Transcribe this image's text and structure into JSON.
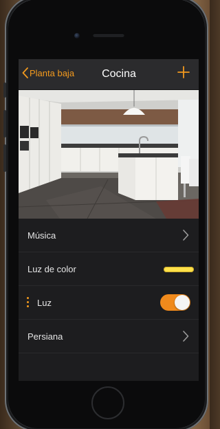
{
  "nav": {
    "back_label": "Planta baja",
    "title": "Cocina",
    "add_icon": "plus-icon"
  },
  "room": {
    "photo_icon": "kitchen-photo"
  },
  "rows": [
    {
      "label": "Música",
      "control": "chevron-right-icon"
    },
    {
      "label": "Luz de color",
      "control": "color-swatch",
      "color": "#ffe14a"
    },
    {
      "label": "Luz",
      "control": "toggle",
      "state": "on",
      "drag_icon": "drag-handle-icon"
    },
    {
      "label": "Persiana",
      "control": "chevron-right-icon"
    }
  ],
  "colors": {
    "accent": "#f39a1e",
    "toggle_on": "#f08a1c",
    "screen_bg": "#1d1d1f",
    "navbar_bg": "#2b2b2d"
  }
}
